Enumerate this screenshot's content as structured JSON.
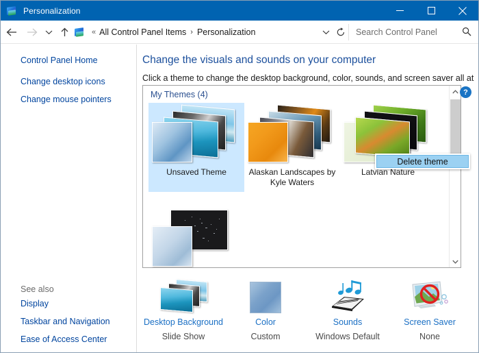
{
  "window": {
    "title": "Personalization",
    "app_icon": "personalization-icon",
    "minimize_label": "Minimize",
    "maximize_label": "Maximize",
    "close_label": "Close",
    "titlebar_color": "#0063B1"
  },
  "nav": {
    "back_label": "Back",
    "forward_label": "Forward",
    "recent_label": "Recent locations",
    "up_label": "Up one level",
    "breadcrumb": {
      "overflow": "«",
      "items": [
        "All Control Panel Items",
        "Personalization"
      ],
      "separator": "›"
    },
    "dropdown_label": "Previous locations",
    "refresh_label": "Refresh"
  },
  "search": {
    "placeholder": "Search Control Panel",
    "value": "",
    "icon": "search-icon"
  },
  "help": {
    "label": "?",
    "tooltip": "Help"
  },
  "sidebar": {
    "home_link": "Control Panel Home",
    "links": [
      "Change desktop icons",
      "Change mouse pointers"
    ],
    "see_also": {
      "title": "See also",
      "links": [
        "Display",
        "Taskbar and Navigation",
        "Ease of Access Center"
      ]
    }
  },
  "main": {
    "heading": "Change the visuals and sounds on your computer",
    "subheading": "Click a theme to change the desktop background, color, sounds, and screen saver all at once."
  },
  "themes": {
    "group_label": "My Themes (4)",
    "items": [
      {
        "name": "Unsaved Theme",
        "selected": true
      },
      {
        "name": "Alaskan Landscapes by Kyle Waters",
        "selected": false
      },
      {
        "name": "Latvian Nature",
        "selected": false
      },
      {
        "name": "",
        "selected": false
      }
    ]
  },
  "context_menu": {
    "items": [
      {
        "label": "Delete theme",
        "highlighted": true
      }
    ],
    "highlight_color": "#9BD1F2"
  },
  "scrollbar": {
    "up_label": "Scroll up",
    "down_label": "Scroll down",
    "thumb_label": "Vertical scroll thumb"
  },
  "bottom_bar": {
    "items": [
      {
        "icon": "desktop-background-icon",
        "link": "Desktop Background",
        "value": "Slide Show"
      },
      {
        "icon": "color-swatch-icon",
        "link": "Color",
        "value": "Custom"
      },
      {
        "icon": "sounds-icon",
        "link": "Sounds",
        "value": "Windows Default"
      },
      {
        "icon": "screen-saver-icon",
        "link": "Screen Saver",
        "value": "None"
      }
    ]
  }
}
